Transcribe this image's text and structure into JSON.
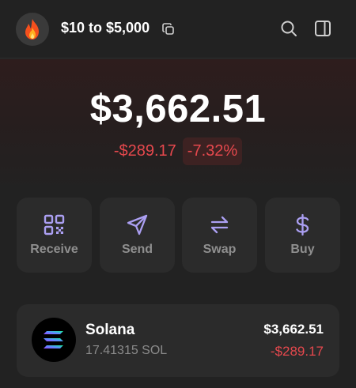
{
  "header": {
    "wallet_name": "$10 to $5,000",
    "avatar_icon": "fire-emoji-icon",
    "copy_icon": "copy-icon",
    "search_icon": "search-icon",
    "panel_icon": "sidebar-panel-icon"
  },
  "portfolio": {
    "balance": "$3,662.51",
    "change_amount": "-$289.17",
    "change_percent": "-7.32%"
  },
  "actions": [
    {
      "label": "Receive",
      "icon": "qr-code-icon"
    },
    {
      "label": "Send",
      "icon": "paper-plane-icon"
    },
    {
      "label": "Swap",
      "icon": "swap-arrows-icon"
    },
    {
      "label": "Buy",
      "icon": "dollar-icon"
    }
  ],
  "tokens": [
    {
      "name": "Solana",
      "amount": "17.41315 SOL",
      "value": "$3,662.51",
      "change": "-$289.17",
      "icon": "solana-logo-icon"
    }
  ],
  "colors": {
    "background": "#222222",
    "card": "#2b2b2b",
    "accent_purple": "#ab9ff2",
    "negative": "#e5484d"
  }
}
